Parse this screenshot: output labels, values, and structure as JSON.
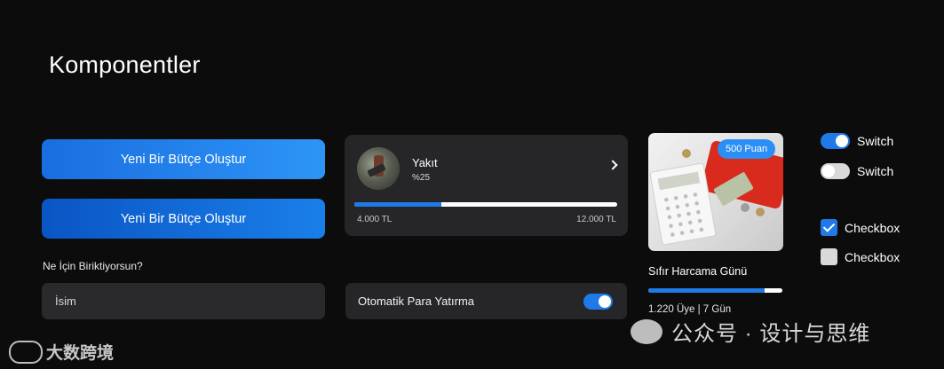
{
  "page": {
    "title": "Komponentler"
  },
  "buttons": {
    "primary_label": "Yeni Bir Bütçe Oluştur",
    "secondary_label": "Yeni Bir Bütçe Oluştur"
  },
  "savings_field": {
    "label": "Ne İçin Biriktiyorsun?",
    "placeholder": "İsim"
  },
  "budget_card": {
    "name": "Yakıt",
    "percent_text": "%25",
    "progress_fraction": 0.33,
    "min_amount": "4.000 TL",
    "max_amount": "12.000 TL",
    "icon": "fuel-pump-photo",
    "fill_color": "#1f7ae8"
  },
  "auto_deposit": {
    "label": "Otomatik Para Yatırma",
    "enabled": true
  },
  "challenge_card": {
    "badge": "500 Puan",
    "title": "Sıfır Harcama Günü",
    "progress_fraction": 0.87,
    "meta": "1.220 Üye | 7 Gün",
    "image": "calculator-wallet-photo"
  },
  "switches": [
    {
      "label": "Switch",
      "on": true
    },
    {
      "label": "Switch",
      "on": false
    }
  ],
  "checkboxes": [
    {
      "label": "Checkbox",
      "checked": true
    },
    {
      "label": "Checkbox",
      "checked": false
    }
  ],
  "watermarks": {
    "left": "大数跨境",
    "right": "公众号 · 设计与思维"
  },
  "colors": {
    "accent": "#1f7ae8",
    "background": "#0c0c0c",
    "card": "#262628",
    "badge": "#2b8ff5"
  }
}
